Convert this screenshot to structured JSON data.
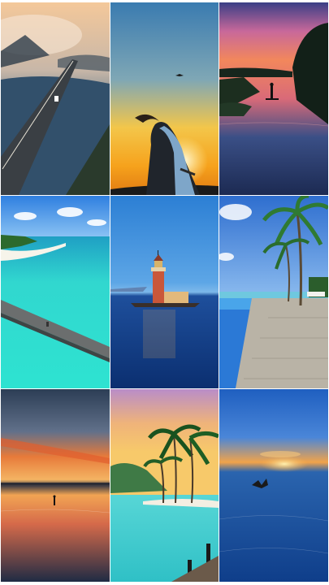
{
  "gallery": {
    "layout": "3x3 grid",
    "tiles": [
      {
        "scene": "bridge-over-water-at-dusk"
      },
      {
        "scene": "woman-silhouette-at-sunset"
      },
      {
        "scene": "paddleboarder-on-lake-at-sunset"
      },
      {
        "scene": "tropical-beach-with-pier"
      },
      {
        "scene": "lighthouse-on-island-at-blue-hour"
      },
      {
        "scene": "infinity-pool-with-palm-trees"
      },
      {
        "scene": "person-walking-on-beach-at-sunset"
      },
      {
        "scene": "palm-trees-over-turquoise-lagoon"
      },
      {
        "scene": "bird-over-sea-at-sunrise"
      }
    ]
  },
  "colors": {
    "background": "#ffffff",
    "sunset_orange": "#f5a623",
    "lagoon_turquoise": "#2fd3c8",
    "deep_blue": "#0e3f8c"
  }
}
